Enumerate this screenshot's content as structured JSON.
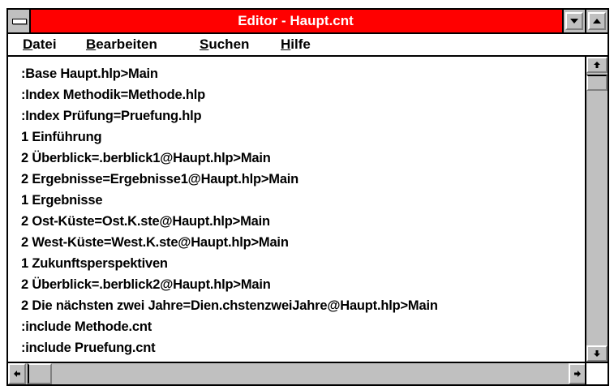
{
  "window": {
    "title": "Editor - Haupt.cnt"
  },
  "menu": [
    {
      "label_underlined": "D",
      "label_rest": "atei"
    },
    {
      "label_underlined": "B",
      "label_rest": "earbeiten"
    },
    {
      "label_underlined": "S",
      "label_rest": "uchen"
    },
    {
      "label_underlined": "H",
      "label_rest": "ilfe"
    }
  ],
  "content": {
    "lines": [
      ":Base Haupt.hlp>Main",
      ":Index Methodik=Methode.hlp",
      ":Index Prüfung=Pruefung.hlp",
      "1 Einführung",
      "2 Überblick=.berblick1@Haupt.hlp>Main",
      "2 Ergebnisse=Ergebnisse1@Haupt.hlp>Main",
      "1 Ergebnisse",
      "2 Ost-Küste=Ost.K.ste@Haupt.hlp>Main",
      "2 West-Küste=West.K.ste@Haupt.hlp>Main",
      "1 Zukunftsperspektiven",
      "2 Überblick=.berblick2@Haupt.hlp>Main",
      "2 Die nächsten zwei Jahre=Dien.chstenzweiJahre@Haupt.hlp>Main",
      ":include Methode.cnt",
      ":include Pruefung.cnt"
    ]
  },
  "icons": {
    "system_menu": "system-menu-icon",
    "minimize": "minimize-icon",
    "maximize": "maximize-icon",
    "scroll_up": "arrow-up-icon",
    "scroll_down": "arrow-down-icon",
    "scroll_left": "arrow-left-icon",
    "scroll_right": "arrow-right-icon"
  },
  "colors": {
    "titlebar": "#ff0000",
    "chrome": "#c0c0c0"
  }
}
